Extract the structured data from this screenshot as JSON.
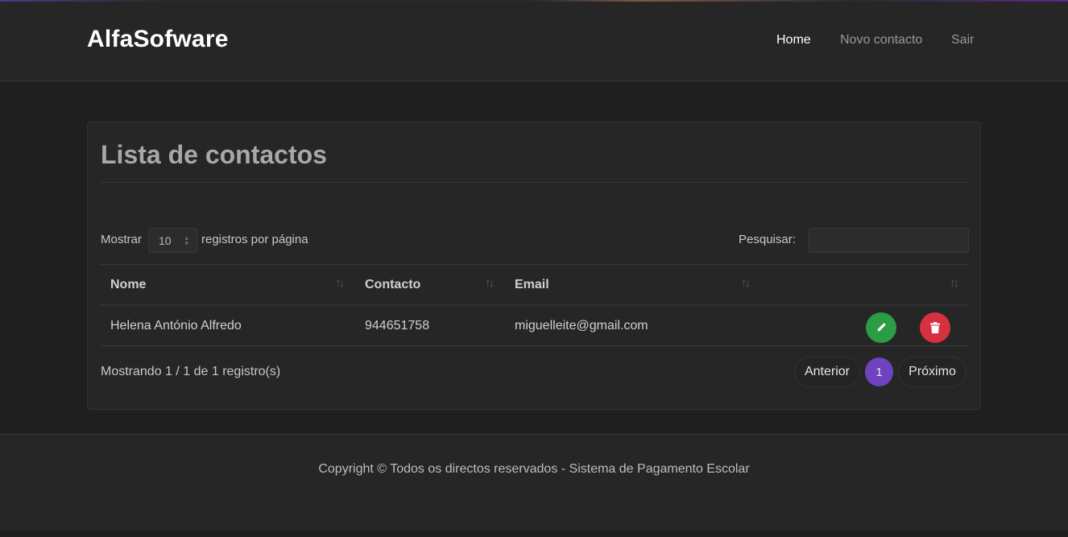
{
  "navbar": {
    "brand": "AlfaSofware",
    "links": [
      {
        "label": "Home",
        "active": true
      },
      {
        "label": "Novo contacto",
        "active": false
      },
      {
        "label": "Sair",
        "active": false
      }
    ]
  },
  "card": {
    "title": "Lista de contactos"
  },
  "length_menu": {
    "prefix": "Mostrar",
    "value": "10",
    "suffix": "registros por página"
  },
  "search": {
    "label": "Pesquisar:",
    "value": ""
  },
  "table": {
    "columns": [
      "Nome",
      "Contacto",
      "Email",
      ""
    ],
    "sort_icon": "↑↓",
    "rows": [
      {
        "nome": "Helena António Alfredo",
        "contacto": "944651758",
        "email": "miguelleite@gmail.com"
      }
    ]
  },
  "icons": {
    "edit": "pencil-icon",
    "delete": "trash-icon"
  },
  "colors": {
    "edit_button": "#2a9d45",
    "delete_button": "#d7303f",
    "active_page": "#6f42c1"
  },
  "info": "Mostrando 1 / 1 de 1 registro(s)",
  "pagination": {
    "previous": "Anterior",
    "current": "1",
    "next": "Próximo"
  },
  "footer": {
    "text": "Copyright © Todos os directos reservados - Sistema de Pagamento Escolar"
  }
}
